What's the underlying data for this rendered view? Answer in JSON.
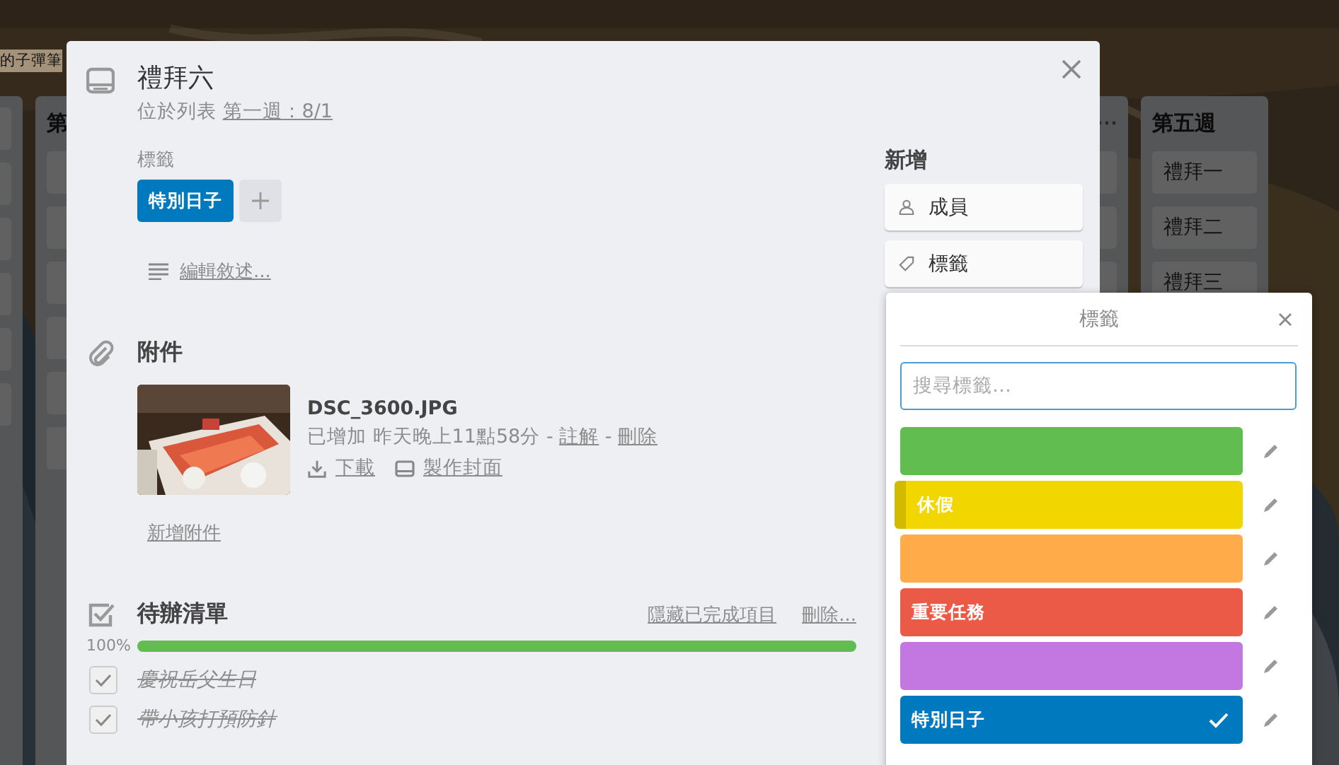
{
  "board": {
    "title": "的子彈筆",
    "lists": [
      {
        "kind": "edge"
      },
      {
        "kind": "titled",
        "title": "第"
      },
      {
        "kind": "menu"
      },
      {
        "kind": "titled",
        "title": "第五週",
        "cards": [
          "禮拜一",
          "禮拜二",
          "禮拜三"
        ]
      }
    ]
  },
  "card": {
    "title": "禮拜六",
    "list_prefix": "位於列表",
    "list_name": "第一週：8/1",
    "labels": {
      "heading": "標籤",
      "items": [
        {
          "text": "特別日子",
          "color": "#0079bf"
        }
      ]
    },
    "description_link": "編輯敘述...",
    "attachments": {
      "heading": "附件",
      "items": [
        {
          "name": "DSC_3600.JPG",
          "added": "已增加 昨天晚上11點58分 -",
          "comment": "註解",
          "separator": "-",
          "delete": "刪除",
          "download": "下載",
          "cover": "製作封面"
        }
      ],
      "add": "新增附件"
    },
    "checklist": {
      "title": "待辦清單",
      "hide": "隱藏已完成項目",
      "delete": "刪除...",
      "percent": "100%",
      "level": 1,
      "items": [
        {
          "text": "慶祝岳父生日",
          "checked": true
        },
        {
          "text": "帶小孩打預防針",
          "checked": true
        }
      ]
    }
  },
  "sidebar": {
    "heading": "新增",
    "buttons": [
      {
        "kind": "member",
        "text": "成員"
      },
      {
        "kind": "label",
        "text": "標籤"
      }
    ]
  },
  "popover": {
    "title": "標籤",
    "placeholder": "搜尋標籤…",
    "labels": [
      {
        "color": "#61bd4f",
        "selected": false,
        "hovered": false
      },
      {
        "color": "#f2d600",
        "text": "休假",
        "selected": false,
        "hovered": true
      },
      {
        "color": "#ffab4a",
        "selected": false,
        "hovered": false
      },
      {
        "color": "#eb5a46",
        "text": "重要任務",
        "selected": false,
        "hovered": false
      },
      {
        "color": "#c377e0",
        "selected": false,
        "hovered": false
      },
      {
        "color": "#0079bf",
        "text": "特別日子",
        "selected": true,
        "hovered": false
      }
    ]
  }
}
